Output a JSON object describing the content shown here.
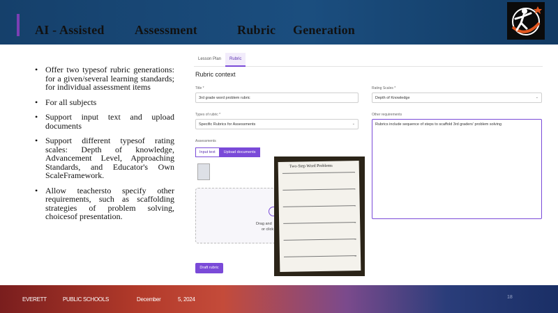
{
  "header": {
    "title_words": [
      "AI - Assisted",
      "Assessment",
      "Rubric",
      "Generation"
    ]
  },
  "bullets": [
    "Offer two typesof rubric generations: for a given/several learning standards; for individual assessment items",
    "For all subjects",
    "Support input text and upload documents",
    "Support different typesof rating scales: Depth of knowledge, Advancement Level, Approaching Standards, and Educator's Own ScaleFramework.",
    "Allow teachersto specify other requirements, such as scaffolding strategies of problem solving, choicesof presentation."
  ],
  "app": {
    "tabs": [
      {
        "label": "Lesson Plan",
        "active": false
      },
      {
        "label": "Rubric",
        "active": true
      }
    ],
    "section_title": "Rubric context",
    "title_label": "Title *",
    "title_value": "3rd grade word problem rubric",
    "rating_label": "Rating Scales *",
    "rating_value": "Depth of Knowledge",
    "type_label": "Types of rubric *",
    "type_value": "Specific Rubrics for Assessments",
    "other_label": "Other requirements",
    "other_value": "Rubrics include sequence of steps to scaffold 3rd graders' problem solving",
    "assessments_label": "Assessments",
    "input_text_btn": "Input text",
    "upload_btn": "Upload documents",
    "drop_text": "Drag and",
    "drop_text2": "or click",
    "draft_btn": "Draft rubric"
  },
  "photo": {
    "sheet_title": "Two-Step Word Problems"
  },
  "footer": {
    "org1": "EVERETT",
    "org2": "PUBLIC SCHOOLS",
    "month": "December",
    "date": "5, 2024",
    "page": "18"
  },
  "colors": {
    "header_bg": "#1b4e7f",
    "accent": "#7a4ad8"
  }
}
